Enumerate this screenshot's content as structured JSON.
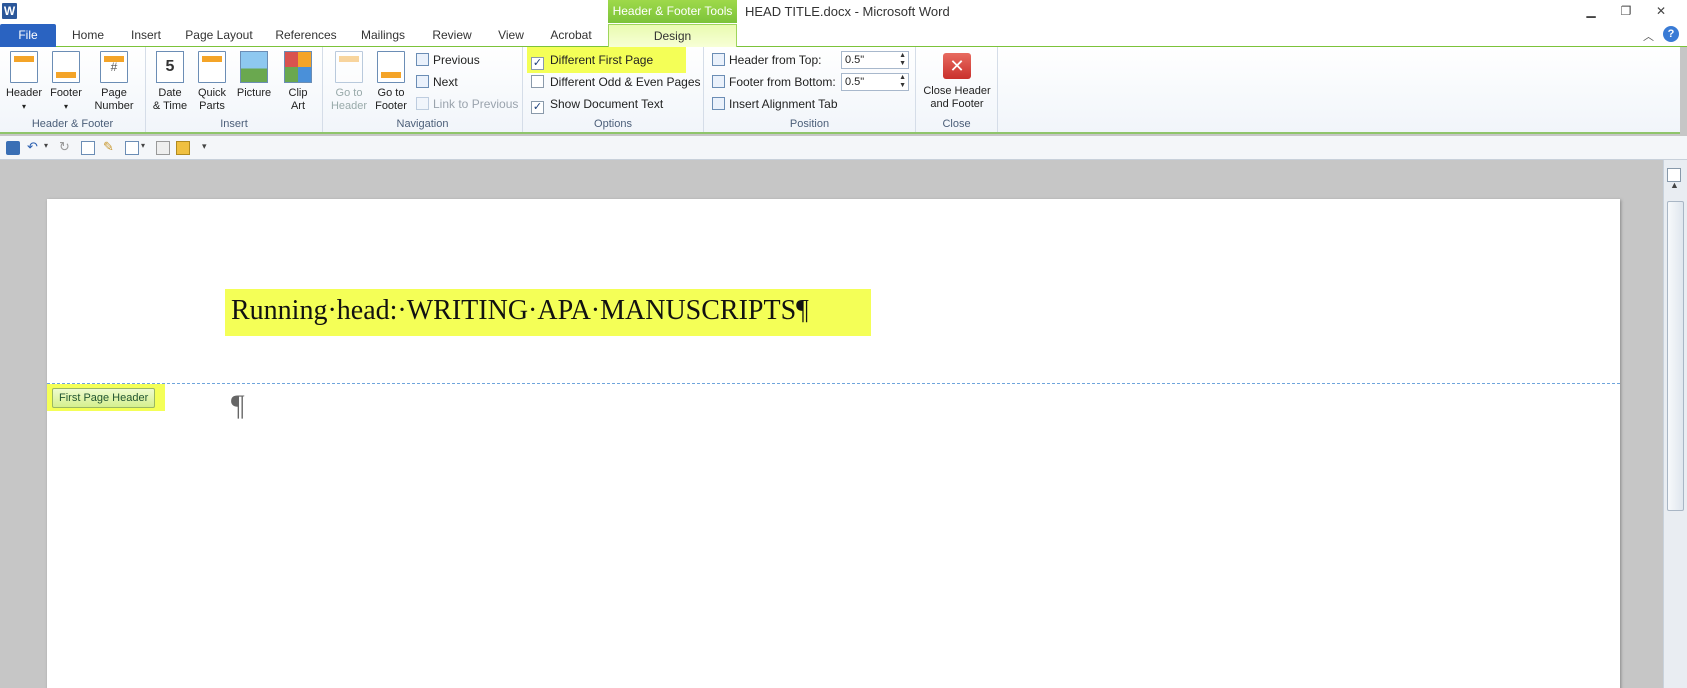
{
  "app": {
    "logo": "W",
    "context_tab_title": "Header & Footer Tools",
    "doc_title": "HEAD TITLE.docx  -  Microsoft Word"
  },
  "window_controls": {
    "minimize": "▁",
    "restore": "❐",
    "close": "✕"
  },
  "tabs": [
    "File",
    "Home",
    "Insert",
    "Page Layout",
    "References",
    "Mailings",
    "Review",
    "View",
    "Acrobat",
    "Design"
  ],
  "ribbon": {
    "header_footer": {
      "label": "Header & Footer",
      "header": "Header",
      "footer": "Footer",
      "page_number_1": "Page",
      "page_number_2": "Number"
    },
    "insert": {
      "label": "Insert",
      "date_1": "Date",
      "date_2": "& Time",
      "quick_1": "Quick",
      "quick_2": "Parts",
      "picture": "Picture",
      "clip_1": "Clip",
      "clip_2": "Art"
    },
    "navigation": {
      "label": "Navigation",
      "goto_header_1": "Go to",
      "goto_header_2": "Header",
      "goto_footer_1": "Go to",
      "goto_footer_2": "Footer",
      "previous": "Previous",
      "next": "Next",
      "link_previous": "Link to Previous"
    },
    "options": {
      "label": "Options",
      "different_first_page": "Different First Page",
      "different_odd_even": "Different Odd & Even Pages",
      "show_document_text": "Show Document Text",
      "different_first_page_checked": true,
      "different_odd_even_checked": false,
      "show_document_text_checked": true
    },
    "position": {
      "label": "Position",
      "header_from_top": "Header from Top:",
      "header_from_top_value": "0.5\"",
      "footer_from_bottom": "Footer from Bottom:",
      "footer_from_bottom_value": "0.5\"",
      "insert_alignment_tab": "Insert Alignment Tab"
    },
    "close": {
      "label": "Close",
      "close_1": "Close Header",
      "close_2": "and Footer"
    }
  },
  "document": {
    "running_head": "Running·head:·WRITING·APA·MANUSCRIPTS¶",
    "pilcrow": "¶",
    "first_page_header_tag": "First Page Header"
  },
  "colors": {
    "highlight": "#f4ff57",
    "file_tab": "#2a63c1",
    "context_green": "#7cc33a"
  }
}
